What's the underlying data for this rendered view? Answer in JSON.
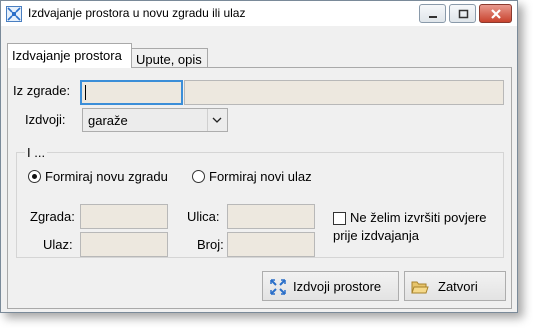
{
  "window": {
    "title": "Izdvajanje prostora u novu zgradu ili ulaz"
  },
  "tabs": [
    {
      "label": "Izdvajanje prostora"
    },
    {
      "label": "Upute, opis"
    }
  ],
  "form": {
    "iz_zgrade_label": "Iz zgrade:",
    "iz_zgrade_code": "",
    "iz_zgrade_name": "",
    "izdvoji_label": "Izdvoji:",
    "izdvoji_value": "garaže"
  },
  "group": {
    "legend": "I ...",
    "radio_nova_zgrada": "Formiraj novu zgradu",
    "radio_novi_ulaz": "Formiraj novi ulaz",
    "selected_option": "Formiraj novu zgradu",
    "zgrada_label": "Zgrada:",
    "ulaz_label": "Ulaz:",
    "ulica_label": "Ulica:",
    "broj_label": "Broj:",
    "checkbox_line1": "Ne želim izvršiti povjere",
    "checkbox_line2": "prije izdvajanja",
    "checkbox_checked": false
  },
  "buttons": {
    "izdvoji": "Izdvoji prostore",
    "zatvori": "Zatvori"
  },
  "icons": [
    "app-icon",
    "minimize-icon",
    "maximize-icon",
    "close-icon",
    "dropdown-arrow-icon",
    "split-icon",
    "folder-icon"
  ]
}
